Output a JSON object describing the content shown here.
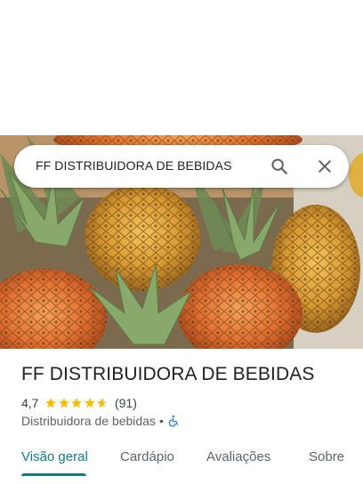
{
  "search": {
    "query": "FF DISTRIBUIDORA DE BEBIDAS"
  },
  "icons": {
    "search": "search-icon",
    "close": "close-icon",
    "accessibility": "wheelchair-icon",
    "star": "star-icon"
  },
  "place": {
    "name": "FF DISTRIBUIDORA DE BEBIDAS",
    "rating": "4,7",
    "rating_value": 4.7,
    "review_count": "(91)",
    "category": "Distribuidora de bebidas",
    "separator": "•"
  },
  "tabs": [
    {
      "label": "Visão geral",
      "active": true
    },
    {
      "label": "Cardápio",
      "active": false
    },
    {
      "label": "Avaliações",
      "active": false
    },
    {
      "label": "Sobre",
      "active": false
    }
  ],
  "colors": {
    "accent": "#137b86",
    "star": "#fbbc04",
    "wheelchair": "#1a73e8"
  }
}
